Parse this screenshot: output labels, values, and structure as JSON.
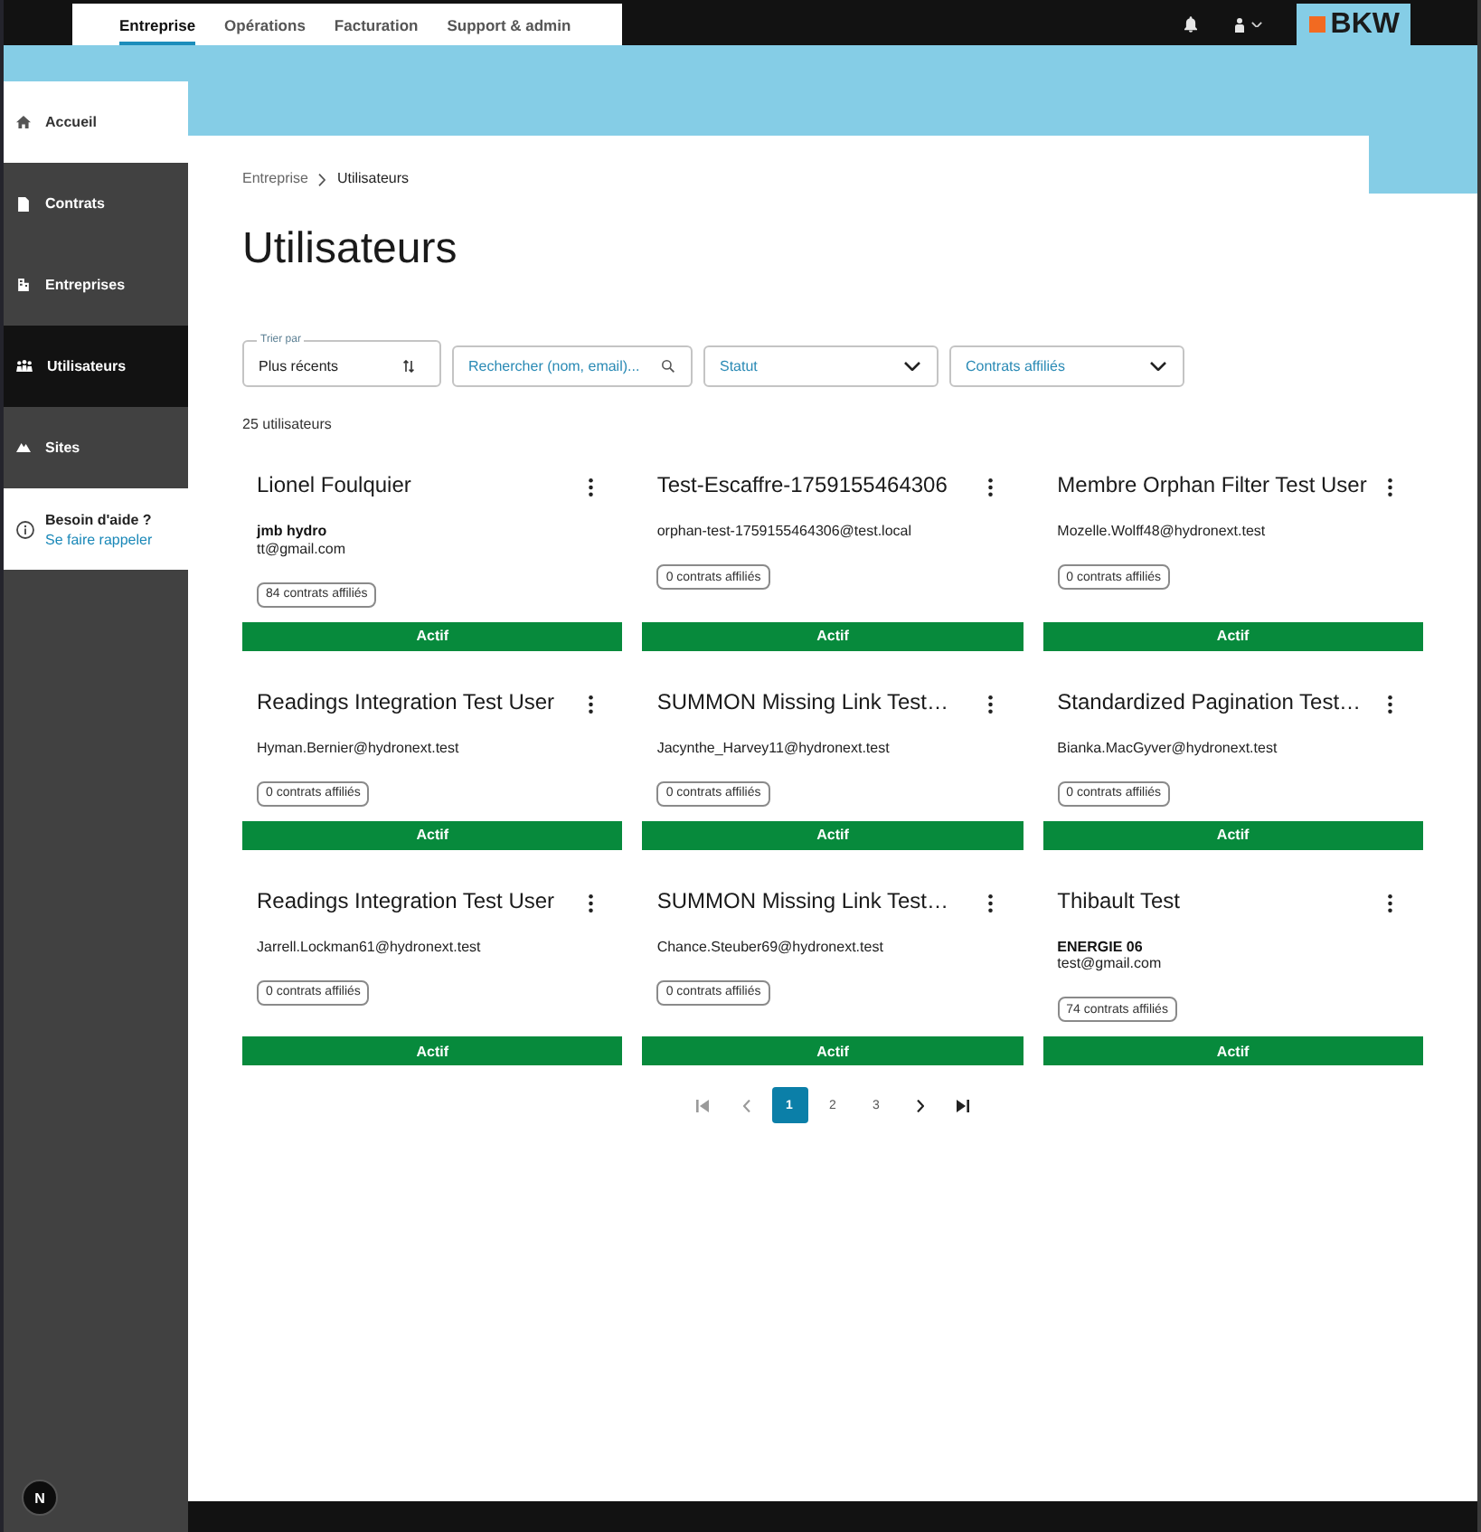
{
  "top_nav": {
    "tabs": [
      {
        "label": "Entreprise",
        "selected": true
      },
      {
        "label": "Opérations",
        "selected": false
      },
      {
        "label": "Facturation",
        "selected": false
      },
      {
        "label": "Support & admin",
        "selected": false
      }
    ],
    "logo": "BKW"
  },
  "sidebar": {
    "items": [
      {
        "label": "Accueil",
        "kind": "home",
        "selected": false
      },
      {
        "label": "Contrats",
        "kind": "link",
        "selected": false
      },
      {
        "label": "Entreprises",
        "kind": "link",
        "selected": false
      },
      {
        "label": "Utilisateurs",
        "kind": "link",
        "selected": true
      },
      {
        "label": "Sites",
        "kind": "link",
        "selected": false
      }
    ],
    "help": {
      "title": "Besoin d'aide ?",
      "link": "Se faire rappeler"
    }
  },
  "dev_badge": "N",
  "breadcrumb": [
    "Entreprise",
    "Utilisateurs"
  ],
  "page_title": "Utilisateurs",
  "filters": {
    "sort": {
      "label": "Trier par",
      "value": "Plus récents"
    },
    "search": {
      "placeholder": "Rechercher (nom, email)..."
    },
    "status": {
      "placeholder": "Statut"
    },
    "contracts": {
      "placeholder": "Contrats affiliés"
    }
  },
  "result_count": "25 utilisateurs",
  "users": [
    {
      "name": "Lionel Foulquier",
      "company": "jmb hydro",
      "email": "tt@gmail.com",
      "contracts": "84 contrats affiliés",
      "status": "Actif"
    },
    {
      "name": "Test-Escaffre-1759155464306",
      "email": "orphan-test-1759155464306@test.local",
      "contracts": "0 contrats affiliés",
      "status": "Actif"
    },
    {
      "name": "Membre Orphan Filter Test User",
      "email": "Mozelle.Wolff48@hydronext.test",
      "contracts": "0 contrats affiliés",
      "status": "Actif"
    },
    {
      "name": "Readings Integration Test User",
      "email": "Hyman.Bernier@hydronext.test",
      "contracts": "0 contrats affiliés",
      "status": "Actif"
    },
    {
      "name": "SUMMON Missing Link Test…",
      "email": "Jacynthe_Harvey11@hydronext.test",
      "contracts": "0 contrats affiliés",
      "status": "Actif"
    },
    {
      "name": "Standardized Pagination Test…",
      "email": "Bianka.MacGyver@hydronext.test",
      "contracts": "0 contrats affiliés",
      "status": "Actif"
    },
    {
      "name": "Readings Integration Test User",
      "email": "Jarrell.Lockman61@hydronext.test",
      "contracts": "0 contrats affiliés",
      "status": "Actif"
    },
    {
      "name": "SUMMON Missing Link Test…",
      "email": "Chance.Steuber69@hydronext.test",
      "contracts": "0 contrats affiliés",
      "status": "Actif"
    },
    {
      "name": "Thibault Test",
      "company": "ENERGIE 06",
      "email": "test@gmail.com",
      "contracts": "74 contrats affiliés",
      "status": "Actif"
    }
  ],
  "pagination": {
    "first": {
      "disabled": true
    },
    "previous": {
      "disabled": true
    },
    "pages": [
      {
        "label": "1",
        "selected": true
      },
      {
        "label": "2",
        "selected": false
      },
      {
        "label": "3",
        "selected": false
      }
    ],
    "next": {
      "disabled": false
    },
    "last": {
      "disabled": false
    }
  }
}
